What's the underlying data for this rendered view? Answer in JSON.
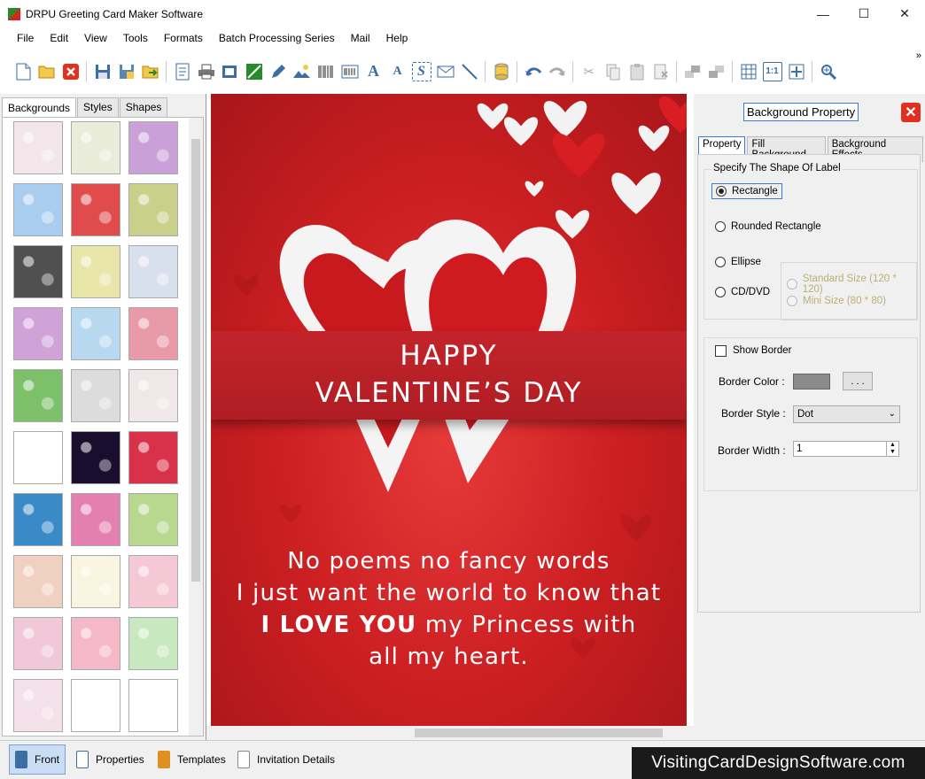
{
  "window": {
    "title": "DRPU Greeting Card Maker Software",
    "minimize": "—",
    "maximize": "☐",
    "close": "✕"
  },
  "menu": [
    "File",
    "Edit",
    "View",
    "Tools",
    "Formats",
    "Batch Processing Series",
    "Mail",
    "Help"
  ],
  "toolbar": {
    "overflow": "»",
    "icons": [
      "new-icon",
      "open-icon",
      "close-doc-icon",
      "save-icon",
      "save-as-icon",
      "export-icon",
      "properties-icon",
      "print-icon",
      "print-preview-icon",
      "image-icon",
      "pencil-icon",
      "picture-icon",
      "barcode-icon",
      "barcode2-icon",
      "wordart-icon",
      "text-icon",
      "signature-icon",
      "mail-icon",
      "line-icon",
      "database-icon",
      "undo-icon",
      "redo-icon",
      "cut-icon",
      "copy-icon",
      "paste-icon",
      "delete-icon",
      "bring-front-icon",
      "send-back-icon",
      "grid-icon",
      "actual-size-icon",
      "fit-icon",
      "zoom-icon"
    ]
  },
  "left_panel": {
    "tabs": [
      "Backgrounds",
      "Styles",
      "Shapes"
    ],
    "active_tab": "Backgrounds",
    "thumbnail_colors": [
      [
        "#f2e6ea",
        "#e9ecd9",
        "#c9a0d8"
      ],
      [
        "#a9cdee",
        "#e04b4b",
        "#c9d08a"
      ],
      [
        "#505050",
        "#e8e6a8",
        "#d8e0ee"
      ],
      [
        "#cfa3d8",
        "#b8d8f0",
        "#e89aa8"
      ],
      [
        "#7cc06a",
        "#dcdcdc",
        "#f0e8e8"
      ],
      [
        "#ffffff",
        "#1a0e2e",
        "#d8324a"
      ],
      [
        "#3a8ac8",
        "#e480b0",
        "#b8d890"
      ],
      [
        "#f0d0c0",
        "#f8f4e0",
        "#f4c8d4"
      ],
      [
        "#f0c8d8",
        "#f4b8c8",
        "#c8e8c0"
      ],
      [
        "#f4e0e8",
        "#ffffff",
        "#ffffff"
      ]
    ]
  },
  "card": {
    "title_line1": "HAPPY",
    "title_line2": "VALENTINE’S DAY",
    "poem_line1": "No poems no fancy words",
    "poem_line2": "I just want the world to know that",
    "poem_line3_bold": "I LOVE YOU",
    "poem_line3_rest": " my Princess with",
    "poem_line4": "all my heart.",
    "bg_color": "#cc1f22"
  },
  "right_panel": {
    "title": "Background Property",
    "tabs": [
      "Property",
      "Fill Background",
      "Background Effects"
    ],
    "active_tab": "Property",
    "shape_group_label": "Specify The Shape Of Label",
    "shapes": [
      "Rectangle",
      "Rounded Rectangle",
      "Ellipse",
      "CD/DVD"
    ],
    "selected_shape": "Rectangle",
    "size_options": [
      "Standard Size (120 * 120)",
      "Mini Size (80 * 80)"
    ],
    "show_border_label": "Show Border",
    "border_color_label": "Border Color :",
    "border_color": "#8a8a8a",
    "border_color_button": ". . .",
    "border_style_label": "Border Style :",
    "border_style_value": "Dot",
    "border_width_label": "Border Width :",
    "border_width_value": "1"
  },
  "bottom": {
    "buttons": [
      "Front",
      "Properties",
      "Templates",
      "Invitation Details"
    ],
    "brand": "VisitingCardDesignSoftware.com"
  }
}
